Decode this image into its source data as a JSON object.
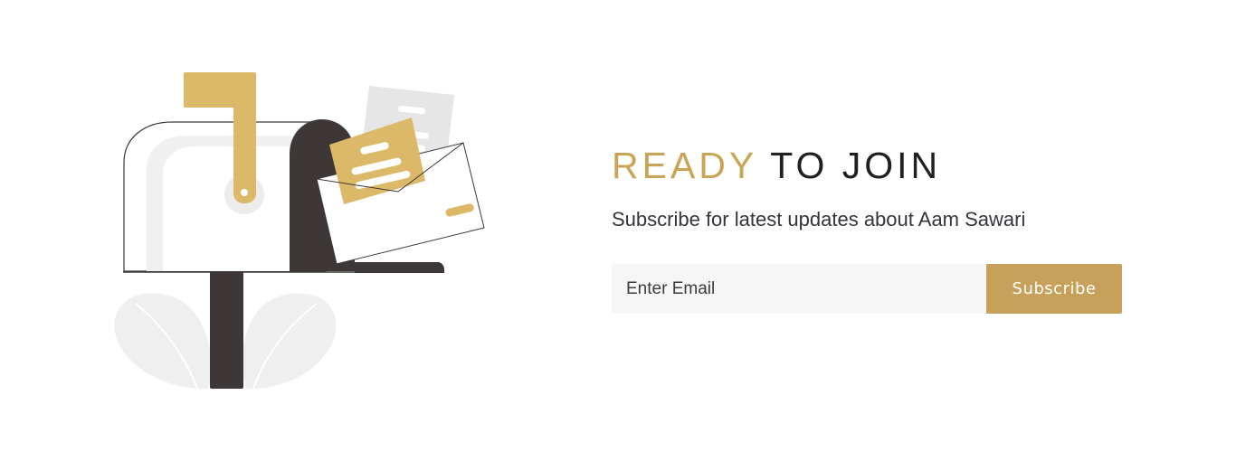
{
  "newsletter": {
    "heading_accent": "READY",
    "heading_rest": "TO JOIN",
    "subtitle": "Subscribe for latest updates about Aam Sawari",
    "email_placeholder": "Enter Email",
    "email_value": "",
    "subscribe_label": "Subscribe"
  },
  "colors": {
    "accent": "#c9a457",
    "button": "#c7a15a",
    "dark": "#1f1f24",
    "input_bg": "#f6f6f6",
    "mailbox_dark": "#3d3837"
  },
  "illustration": {
    "icon": "mailbox-with-letters-icon"
  }
}
